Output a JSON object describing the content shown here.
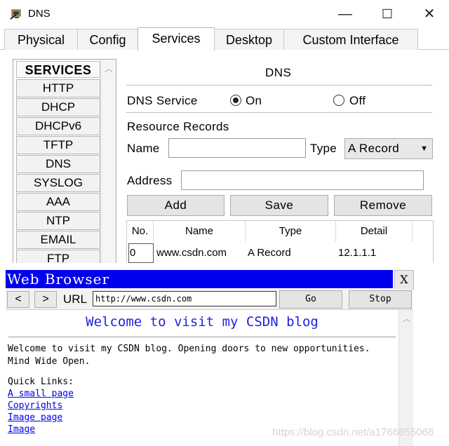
{
  "dns_window": {
    "title": "DNS",
    "controls": {
      "minimize": "—",
      "maximize": "☐",
      "close": "✕"
    },
    "tabs": [
      "Physical",
      "Config",
      "Services",
      "Desktop",
      "Custom Interface"
    ],
    "active_tab": "Services",
    "services": {
      "header": "SERVICES",
      "items": [
        "HTTP",
        "DHCP",
        "DHCPv6",
        "TFTP",
        "DNS",
        "SYSLOG",
        "AAA",
        "NTP",
        "EMAIL",
        "FTP"
      ]
    },
    "section_title": "DNS",
    "dns_service": {
      "label": "DNS Service",
      "on_label": "On",
      "off_label": "Off",
      "selected": "On"
    },
    "resource_records": {
      "label": "Resource Records",
      "name_label": "Name",
      "name_value": "",
      "type_label": "Type",
      "type_value": "A Record",
      "address_label": "Address",
      "address_value": ""
    },
    "buttons": {
      "add": "Add",
      "save": "Save",
      "remove": "Remove"
    },
    "table": {
      "headers": [
        "No.",
        "Name",
        "Type",
        "Detail"
      ],
      "rows": [
        {
          "no": "0",
          "name": "www.csdn.com",
          "type": "A Record",
          "detail": "12.1.1.1"
        }
      ]
    }
  },
  "web_browser": {
    "title": "Web Browser",
    "close": "X",
    "back": "<",
    "forward": ">",
    "url_label": "URL",
    "url": "http://www.csdn.com",
    "go": "Go",
    "stop": "Stop",
    "heading": "Welcome to visit my CSDN blog",
    "body_lines": [
      "Welcome to visit my CSDN blog. Opening doors to new opportunities.",
      "Mind Wide Open."
    ],
    "quick_links_label": "Quick Links:",
    "links": [
      "A small page",
      "Copyrights",
      "Image page",
      "Image"
    ]
  },
  "watermark": "https://blog.csdn.net/a1766855068"
}
